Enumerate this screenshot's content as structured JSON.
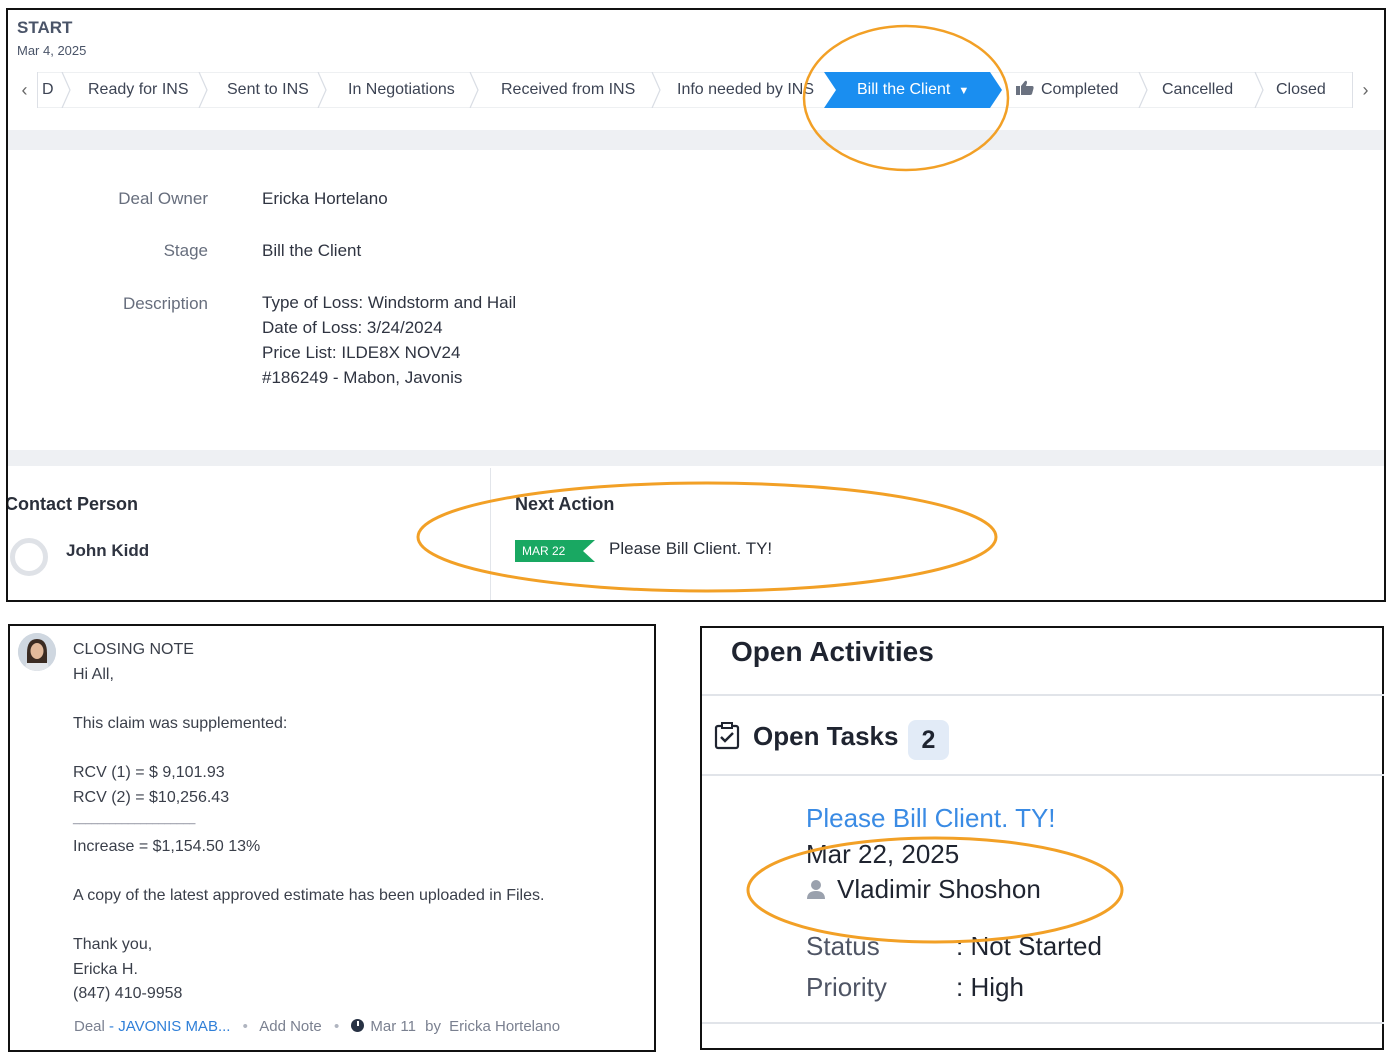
{
  "header": {
    "title": "START",
    "date": "Mar 4, 2025"
  },
  "stage_bar": {
    "prev_icon": "chevron-left-icon",
    "next_icon": "chevron-right-icon",
    "partial_stage": "D",
    "stages": [
      "Ready for INS",
      "Sent to INS",
      "In Negotiations",
      "Received from INS",
      "Info needed by INS",
      "Bill the Client",
      "Completed",
      "Cancelled",
      "Closed"
    ],
    "active_stage": "Bill the Client",
    "active_color": "#1a8ef0",
    "caret_icon": "caret-down-icon",
    "completed_icon": "thumbs-up-icon"
  },
  "details": {
    "owner_label": "Deal Owner",
    "owner_value": "Ericka Hortelano",
    "stage_label": "Stage",
    "stage_value": "Bill the Client",
    "description_label": "Description",
    "description_lines": [
      "Type of Loss: Windstorm and Hail",
      "Date of Loss: 3/24/2024",
      "Price List: ILDE8X NOV24",
      "#186249 - Mabon, Javonis"
    ]
  },
  "contact": {
    "heading": "Contact Person",
    "name": "John Kidd"
  },
  "next_action": {
    "heading": "Next Action",
    "date_tag": "MAR 22",
    "tag_color": "#19a862",
    "text": "Please Bill Client. TY!"
  },
  "closing_note": {
    "lines": [
      "CLOSING NOTE",
      "Hi All,",
      "",
      "This claim was supplemented:",
      "",
      "RCV (1) = $ 9,101.93",
      "RCV (2) = $10,256.43",
      "____________________",
      "Increase = $1,154.50 13%",
      "",
      "A copy of the latest approved estimate has been uploaded in Files.",
      "",
      "Thank you,",
      "Ericka H.",
      "(847) 410-9958"
    ],
    "footer": {
      "deal_label": "Deal",
      "deal_link": "JAVONIS MAB...",
      "add_note": "Add Note",
      "clock_icon": "clock-icon",
      "date": "Mar 11",
      "by_label": "by",
      "author": "Ericka Hortelano"
    }
  },
  "activities": {
    "title": "Open Activities",
    "tasks_icon": "task-checkbox-icon",
    "tasks_label": "Open Tasks",
    "tasks_count": "2",
    "task": {
      "title": "Please Bill Client. TY!",
      "date": "Mar 22, 2025",
      "owner_icon": "user-icon",
      "owner": "Vladimir Shoshon",
      "status_label": "Status",
      "status_value": ": Not Started",
      "priority_label": "Priority",
      "priority_value": ": High"
    }
  },
  "highlight_color": "#f2a026"
}
